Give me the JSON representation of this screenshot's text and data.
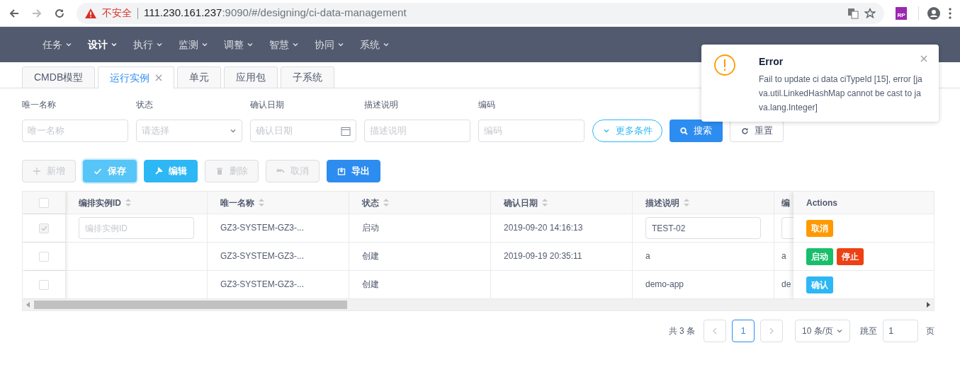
{
  "browser": {
    "security_label": "不安全",
    "url_host": "111.230.161.237",
    "url_rest": ":9090/#/designing/ci-data-management",
    "extension_label": "RP"
  },
  "nav": {
    "items": [
      {
        "label": "任务",
        "selected": false
      },
      {
        "label": "设计",
        "selected": true
      },
      {
        "label": "执行",
        "selected": false
      },
      {
        "label": "监测",
        "selected": false
      },
      {
        "label": "调整",
        "selected": false
      },
      {
        "label": "智慧",
        "selected": false
      },
      {
        "label": "协同",
        "selected": false
      },
      {
        "label": "系统",
        "selected": false
      }
    ]
  },
  "tabs": [
    {
      "label": "CMDB模型",
      "selected": false,
      "closable": false
    },
    {
      "label": "运行实例",
      "selected": true,
      "closable": true
    },
    {
      "label": "单元",
      "selected": false,
      "closable": false
    },
    {
      "label": "应用包",
      "selected": false,
      "closable": false
    },
    {
      "label": "子系统",
      "selected": false,
      "closable": false
    }
  ],
  "filters": [
    {
      "label": "唯一名称",
      "placeholder": "唯一名称",
      "kind": "text"
    },
    {
      "label": "状态",
      "placeholder": "请选择",
      "kind": "select"
    },
    {
      "label": "确认日期",
      "placeholder": "确认日期",
      "kind": "date"
    },
    {
      "label": "描述说明",
      "placeholder": "描述说明",
      "kind": "text"
    },
    {
      "label": "编码",
      "placeholder": "编码",
      "kind": "text"
    }
  ],
  "filter_buttons": [
    {
      "label": "更多条件",
      "kind": "more"
    },
    {
      "label": "搜索",
      "kind": "search"
    },
    {
      "label": "重置",
      "kind": "reset"
    }
  ],
  "toolbar": [
    {
      "label": "新增",
      "kind": "add",
      "disabled": true
    },
    {
      "label": "保存",
      "kind": "save",
      "disabled": false
    },
    {
      "label": "编辑",
      "kind": "edit",
      "disabled": false
    },
    {
      "label": "删除",
      "kind": "delete",
      "disabled": true
    },
    {
      "label": "取消",
      "kind": "cancel",
      "disabled": true
    },
    {
      "label": "导出",
      "kind": "export",
      "disabled": false
    }
  ],
  "table": {
    "header_checked": false,
    "columns": [
      "编排实例ID",
      "唯一名称",
      "状态",
      "确认日期",
      "描述说明",
      "编"
    ],
    "actions_header": "Actions",
    "rows": [
      {
        "checked": true,
        "disabled": true,
        "cells": [
          {
            "kind": "input",
            "placeholder": "编排实例ID"
          },
          {
            "text": "GZ3-SYSTEM-GZ3-..."
          },
          {
            "text": "启动"
          },
          {
            "text": "2019-09-20 14:16:13"
          },
          {
            "kind": "input",
            "value": "TEST-02"
          },
          {
            "kind": "input"
          }
        ],
        "actions": [
          {
            "label": "取消",
            "color": "#ff9900"
          }
        ]
      },
      {
        "checked": false,
        "disabled": false,
        "cells": [
          {
            "text": ""
          },
          {
            "text": "GZ3-SYSTEM-GZ3-..."
          },
          {
            "text": "创建"
          },
          {
            "text": "2019-09-19 20:35:11"
          },
          {
            "text": "a"
          },
          {
            "text": "a"
          }
        ],
        "actions": [
          {
            "label": "启动",
            "color": "#19be6b"
          },
          {
            "label": "停止",
            "color": "#ed4014"
          }
        ]
      },
      {
        "checked": false,
        "disabled": false,
        "cells": [
          {
            "text": ""
          },
          {
            "text": "GZ3-SYSTEM-GZ3-..."
          },
          {
            "text": "创建"
          },
          {
            "text": ""
          },
          {
            "text": "demo-app"
          },
          {
            "text": "de"
          }
        ],
        "actions": [
          {
            "label": "确认",
            "color": "#2db7f5"
          }
        ]
      }
    ]
  },
  "pagination": {
    "total": "共 3 条",
    "pages": [
      {
        "label": "1",
        "selected": true
      }
    ],
    "page_size": "10 条/页",
    "jump_label": "跳至",
    "jump_value": "1",
    "page_suffix": "页"
  },
  "notification": {
    "title": "Error",
    "message": "Fail to update ci data ciTypeId [15], error [java.util.LinkedHashMap cannot be cast to java.lang.Integer]"
  }
}
